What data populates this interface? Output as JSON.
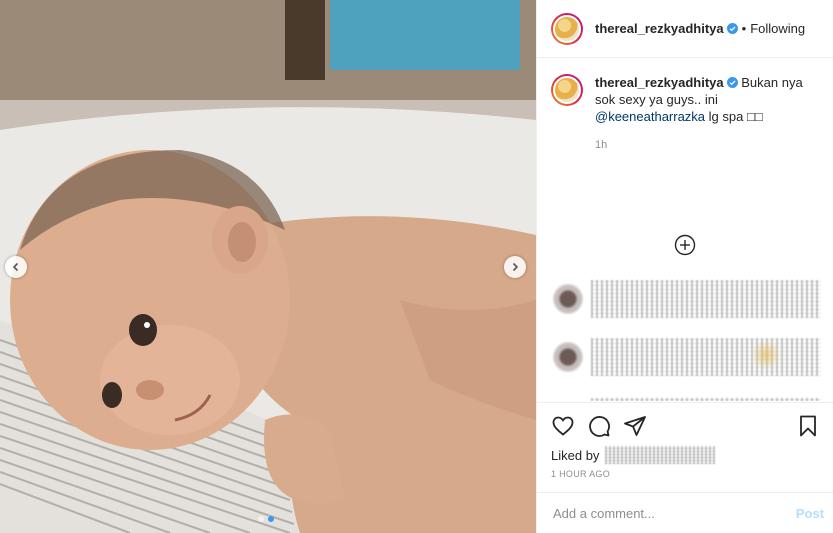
{
  "post": {
    "username": "thereal_rezkyadhitya",
    "separator": "•",
    "follow_status": "Following"
  },
  "caption": {
    "username": "thereal_rezkyadhitya",
    "text_before": "Bukan nya sok sexy ya guys.. ini",
    "mention": "@keeneatharrazka",
    "text_after": "lg spa □□",
    "time": "1h"
  },
  "engagement": {
    "liked_by_label": "Liked by",
    "post_time": "1 HOUR AGO"
  },
  "comment_box": {
    "placeholder": "Add a comment...",
    "post_label": "Post"
  },
  "colors": {
    "accent": "#3897f0",
    "link": "#00376b",
    "post_disabled": "#b2dffc",
    "muted": "#8e8e8e"
  },
  "icons": {
    "heart": "heart-icon",
    "comment": "comment-icon",
    "share": "paper-plane-icon",
    "save": "bookmark-icon",
    "load_more": "plus-circle-icon",
    "prev": "chevron-left-icon",
    "next": "chevron-right-icon"
  },
  "carousel": {
    "count": 2,
    "active_index": 1
  }
}
